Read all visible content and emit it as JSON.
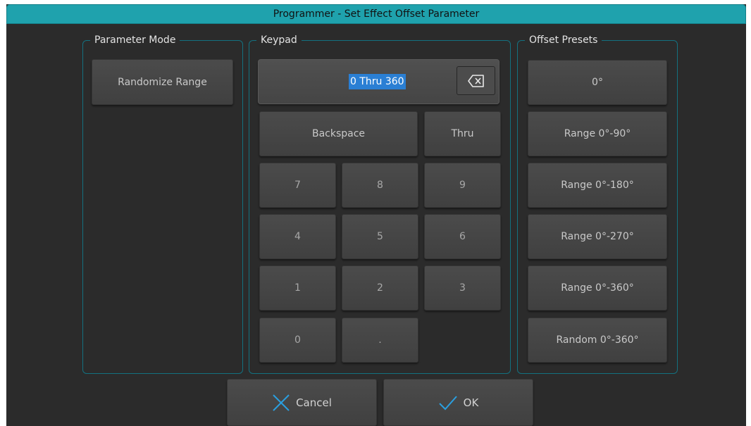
{
  "window": {
    "title": "Programmer - Set Effect Offset Parameter"
  },
  "parameter_mode": {
    "legend": "Parameter Mode",
    "button_label": "Randomize Range"
  },
  "keypad": {
    "legend": "Keypad",
    "display_value": "0 Thru 360",
    "clear_icon": "backspace-clear-icon",
    "backspace_label": "Backspace",
    "thru_label": "Thru",
    "keys": {
      "k7": "7",
      "k8": "8",
      "k9": "9",
      "k4": "4",
      "k5": "5",
      "k6": "6",
      "k1": "1",
      "k2": "2",
      "k3": "3",
      "k0": "0",
      "dot": "."
    }
  },
  "offset_presets": {
    "legend": "Offset Presets",
    "items": [
      "0°",
      "Range 0°-90°",
      "Range 0°-180°",
      "Range 0°-270°",
      "Range 0°-360°",
      "Random 0°-360°"
    ]
  },
  "footer": {
    "cancel_label": "Cancel",
    "cancel_icon": "x-icon",
    "ok_label": "OK",
    "ok_icon": "checkmark-icon",
    "icon_color": "#2a9fe0"
  },
  "colors": {
    "titlebar": "#1fa2ad",
    "background": "#2b2b2b",
    "group_border": "#137180",
    "selection": "#2a7fd4"
  }
}
